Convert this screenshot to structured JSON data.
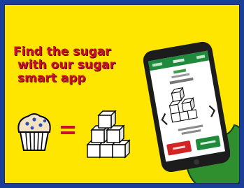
{
  "headline": {
    "line1": "Find the sugar",
    "line2": "with our sugar",
    "line3": "smart app"
  },
  "colors": {
    "frame": "#1a3f99",
    "background": "#ffe600",
    "headline": "#c8102e",
    "phone_body": "#1c1c1c",
    "app_header": "#1f8a3b",
    "hand": "#2f8f2f",
    "button_left": "#d32424",
    "button_right": "#1f8a3b"
  },
  "icons": {
    "food": "muffin-icon",
    "equals": "equals-sign-icon",
    "sugar": "sugar-cubes-icon"
  }
}
